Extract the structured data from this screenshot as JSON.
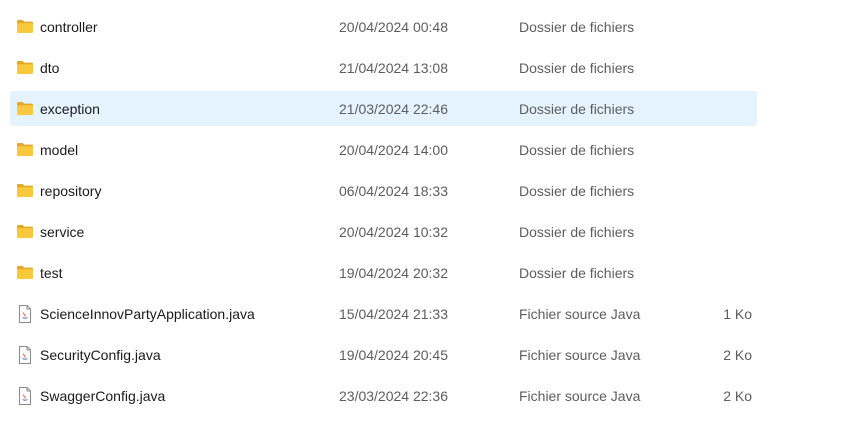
{
  "files": [
    {
      "name": "controller",
      "date": "20/04/2024 00:48",
      "type": "Dossier de fichiers",
      "size": "",
      "icon": "folder-icon",
      "selected": false
    },
    {
      "name": "dto",
      "date": "21/04/2024 13:08",
      "type": "Dossier de fichiers",
      "size": "",
      "icon": "folder-icon",
      "selected": false
    },
    {
      "name": "exception",
      "date": "21/03/2024 22:46",
      "type": "Dossier de fichiers",
      "size": "",
      "icon": "folder-icon",
      "selected": true
    },
    {
      "name": "model",
      "date": "20/04/2024 14:00",
      "type": "Dossier de fichiers",
      "size": "",
      "icon": "folder-icon",
      "selected": false
    },
    {
      "name": "repository",
      "date": "06/04/2024 18:33",
      "type": "Dossier de fichiers",
      "size": "",
      "icon": "folder-icon",
      "selected": false
    },
    {
      "name": "service",
      "date": "20/04/2024 10:32",
      "type": "Dossier de fichiers",
      "size": "",
      "icon": "folder-icon",
      "selected": false
    },
    {
      "name": "test",
      "date": "19/04/2024 20:32",
      "type": "Dossier de fichiers",
      "size": "",
      "icon": "folder-icon",
      "selected": false
    },
    {
      "name": "ScienceInnovPartyApplication.java",
      "date": "15/04/2024 21:33",
      "type": "Fichier source Java",
      "size": "1 Ko",
      "icon": "java-file-icon",
      "selected": false
    },
    {
      "name": "SecurityConfig.java",
      "date": "19/04/2024 20:45",
      "type": "Fichier source Java",
      "size": "2 Ko",
      "icon": "java-file-icon",
      "selected": false
    },
    {
      "name": "SwaggerConfig.java",
      "date": "23/03/2024 22:36",
      "type": "Fichier source Java",
      "size": "2 Ko",
      "icon": "java-file-icon",
      "selected": false
    }
  ],
  "colors": {
    "selection": "#e5f3ff",
    "folder": "#f8c93c",
    "secondary_text": "#5d5d5d"
  }
}
